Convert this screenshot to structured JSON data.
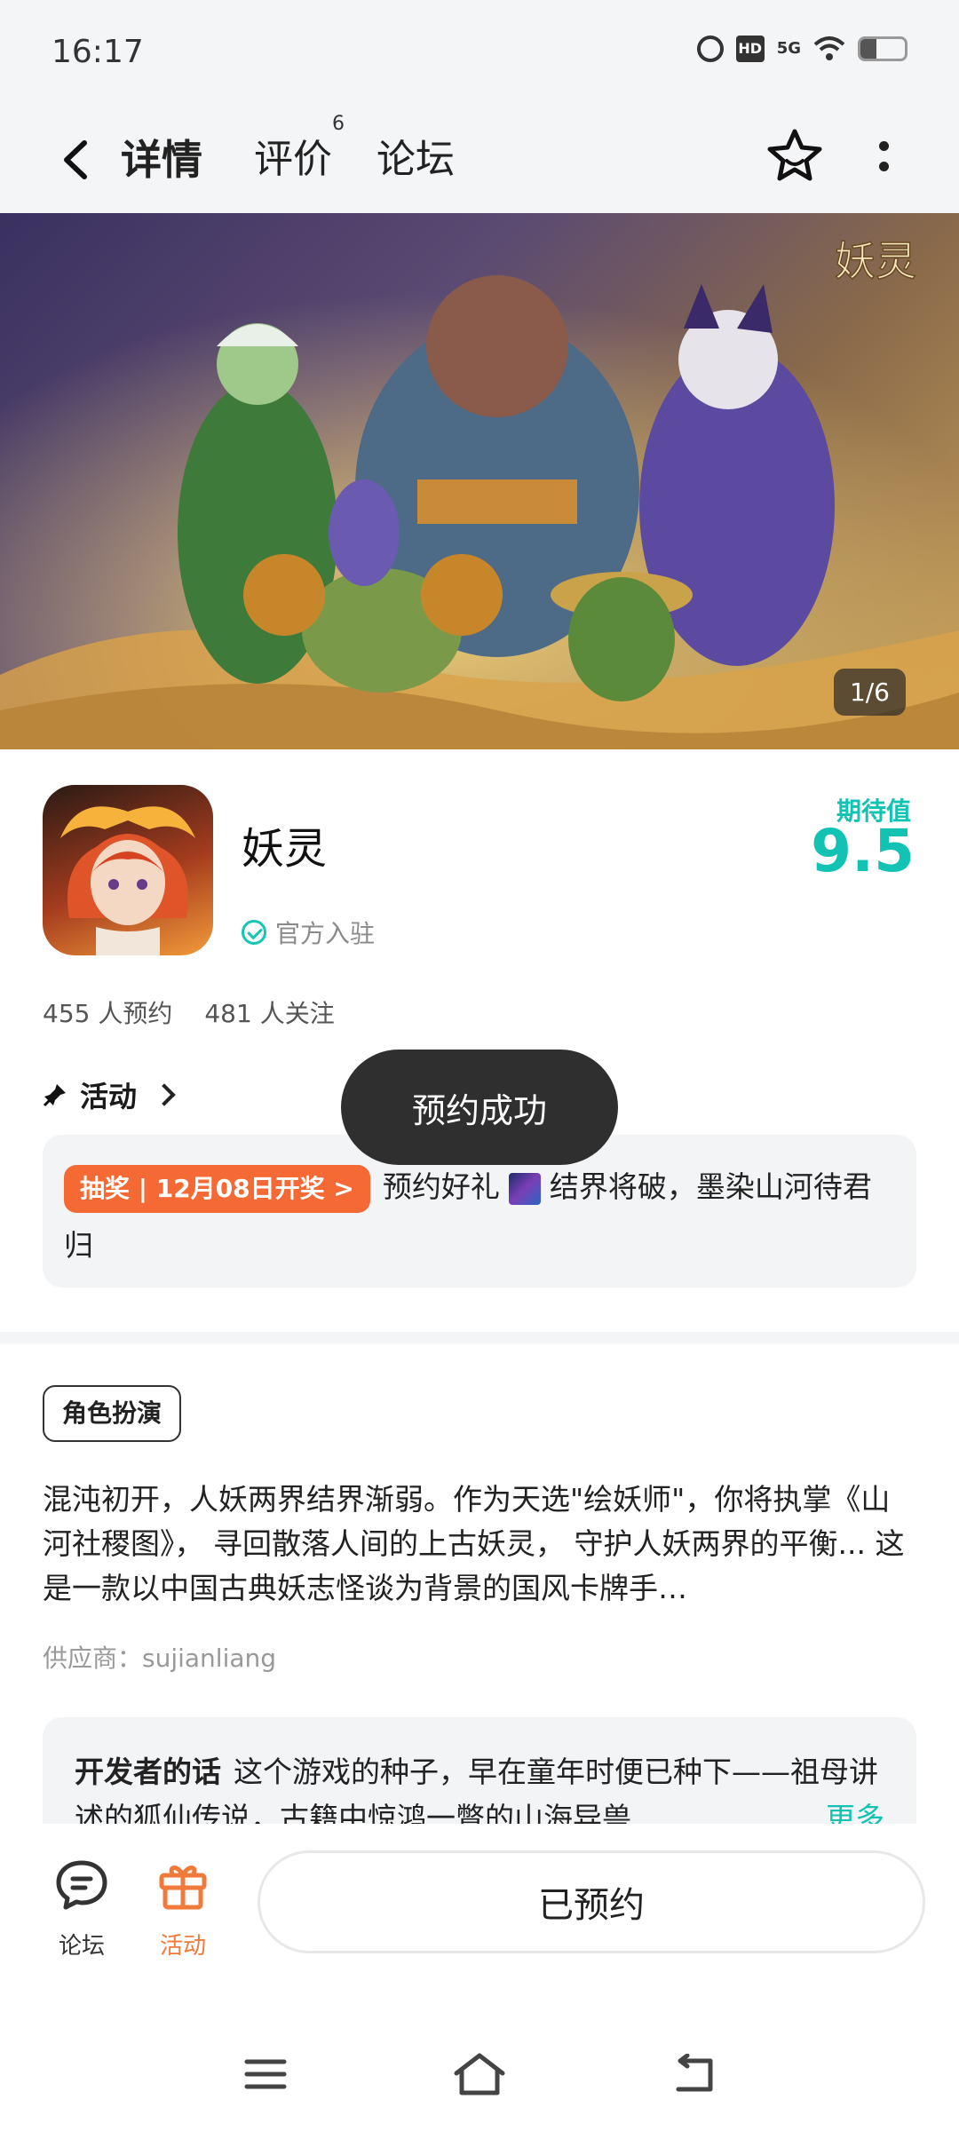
{
  "status_bar": {
    "time": "16:17",
    "icons": [
      "alarm-icon",
      "hd-icon",
      "5g-signal-icon",
      "wifi-icon",
      "battery-icon"
    ],
    "hd_label": "HD",
    "network_label": "5G",
    "battery_level": 0.35
  },
  "nav": {
    "tabs": [
      {
        "label": "详情",
        "active": true
      },
      {
        "label": "评价",
        "badge": "6"
      },
      {
        "label": "论坛"
      }
    ]
  },
  "banner": {
    "logo_text": "妖灵",
    "counter": "1/6"
  },
  "app": {
    "name": "妖灵",
    "official_label": "官方入驻",
    "expect_label": "期待值",
    "expect_value": "9.5",
    "reservations": "455 人预约",
    "followers": "481 人关注"
  },
  "activity": {
    "header": "活动",
    "lottery_tag": "抽奖 | 12月08日开奖 >",
    "text_before": "预约好礼",
    "text_after": "结界将破，墨染山河待君归"
  },
  "toast": "预约成功",
  "detail": {
    "genre": "角色扮演",
    "description": "混沌初开，人妖两界结界渐弱。作为天选\"绘妖师\"，你将执掌《山河社稷图》， 寻回散落人间的上古妖灵， 守护人妖两界的平衡... 这是一款以中国古典妖志怪谈为背景的国风卡牌手…",
    "supplier": "供应商：sujianliang"
  },
  "developer": {
    "title": "开发者的话",
    "text": "这个游戏的种子，早在童年时便已种下——祖母讲述的狐仙传说，古籍中惊鸿一瞥的山海异兽",
    "more": "更多"
  },
  "bottom": {
    "forum_label": "论坛",
    "activity_label": "活动",
    "reserve_label": "已预约",
    "accent": "#f07a3a"
  },
  "colors": {
    "primary": "#12c2b2",
    "lottery": "#f56a34",
    "toast_bg": "#2f2f2f"
  }
}
